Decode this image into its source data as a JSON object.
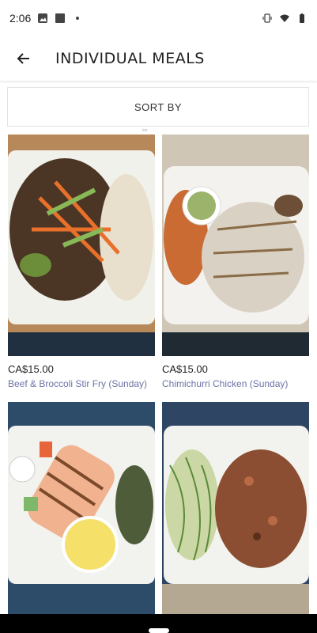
{
  "status": {
    "time": "2:06"
  },
  "header": {
    "title": "INDIVIDUAL MEALS"
  },
  "sort": {
    "label": "SORT BY"
  },
  "tiny_text": "ios",
  "meals": [
    {
      "price": "CA$15.00",
      "name": "Beef & Broccoli Stir Fry (Sunday)"
    },
    {
      "price": "CA$15.00",
      "name": "Chimichurri Chicken (Sunday)"
    },
    {
      "price": "",
      "name": ""
    },
    {
      "price": "",
      "name": ""
    }
  ],
  "colors": {
    "accent_link": "#6d74a6",
    "background": "#ffffff"
  },
  "icons": {
    "back": "arrow-left-icon"
  }
}
